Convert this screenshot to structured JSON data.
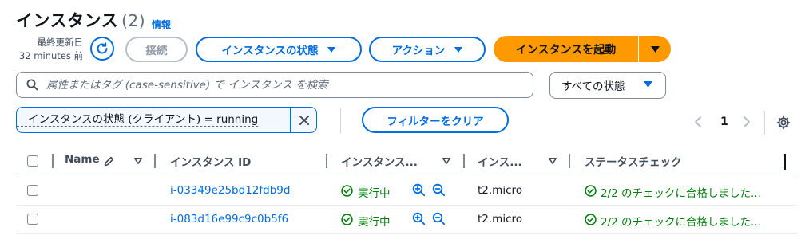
{
  "header": {
    "title": "インスタンス",
    "count": "(2)",
    "info_link": "情報",
    "last_updated_label": "最終更新日",
    "last_updated_value": "32 minutes 前"
  },
  "toolbar": {
    "connect_label": "接続",
    "instance_state_label": "インスタンスの状態",
    "actions_label": "アクション",
    "launch_label": "インスタンスを起動"
  },
  "search": {
    "placeholder": "属性またはタグ (case-sensitive) で インスタンス を検索"
  },
  "state_filter": {
    "selected": "すべての状態"
  },
  "filter_token": {
    "label": "インスタンスの状態 (クライアント) = running"
  },
  "clear_filters_label": "フィルターをクリア",
  "pagination": {
    "current_page": "1"
  },
  "table": {
    "columns": [
      "Name",
      "インスタンス ID",
      "インスタンス...",
      "インス...",
      "ステータスチェック"
    ],
    "rows": [
      {
        "name": "",
        "instance_id": "i-03349e25bd12fdb9d",
        "state": "実行中",
        "type": "t2.micro",
        "status_check": "2/2 のチェックに合格しました..."
      },
      {
        "name": "",
        "instance_id": "i-083d16e99c9c0b5f6",
        "state": "実行中",
        "type": "t2.micro",
        "status_check": "2/2 のチェックに合格しました..."
      }
    ]
  },
  "colors": {
    "link_blue": "#006ce0",
    "primary_orange": "#ff9900",
    "success_green": "#037f0c",
    "border_gray": "#7d8998"
  },
  "icons": [
    "refresh-icon",
    "caret-down-icon",
    "search-icon",
    "close-icon",
    "chevron-left-icon",
    "chevron-right-icon",
    "gear-icon",
    "edit-pencil-icon",
    "sort-icon",
    "success-circle-icon",
    "zoom-in-icon",
    "zoom-out-icon"
  ]
}
